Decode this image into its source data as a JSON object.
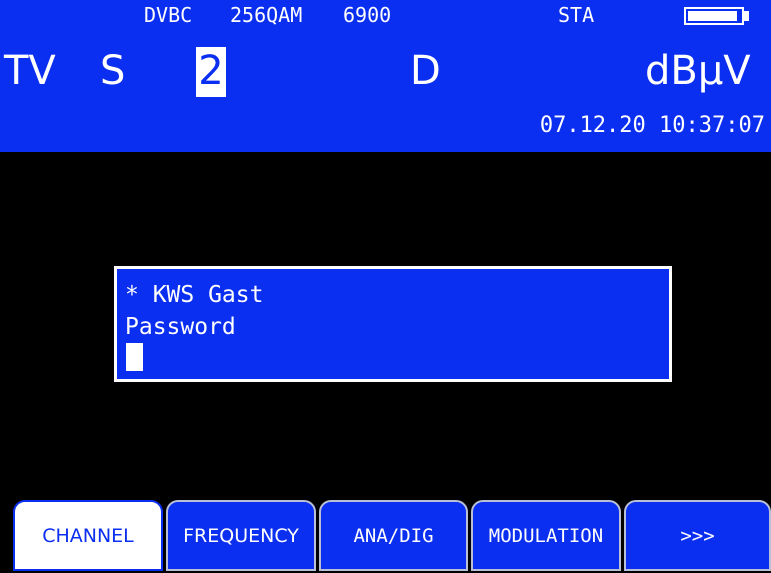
{
  "status_bar": {
    "standard": "DVBC",
    "modulation": "256QAM",
    "symbol_rate": "6900",
    "mode": "STA",
    "battery_level": 0.95
  },
  "main_line": {
    "band": "TV",
    "type": "S",
    "channel": "2",
    "signal": "D",
    "unit": "dBµV"
  },
  "datetime": "07.12.20 10:37:07",
  "dialog": {
    "network": "* KWS Gast",
    "prompt": "Password",
    "value": ""
  },
  "softkeys": [
    {
      "label": "CHANNEL",
      "active": true
    },
    {
      "label": "FREQUENCY",
      "active": false
    },
    {
      "label": "ANA/DIG",
      "active": false
    },
    {
      "label": "MODULATION",
      "active": false
    },
    {
      "label": ">>>",
      "active": false
    }
  ],
  "colors": {
    "accent": "#0b2ff0",
    "background": "#000000",
    "text": "#ffffff"
  }
}
